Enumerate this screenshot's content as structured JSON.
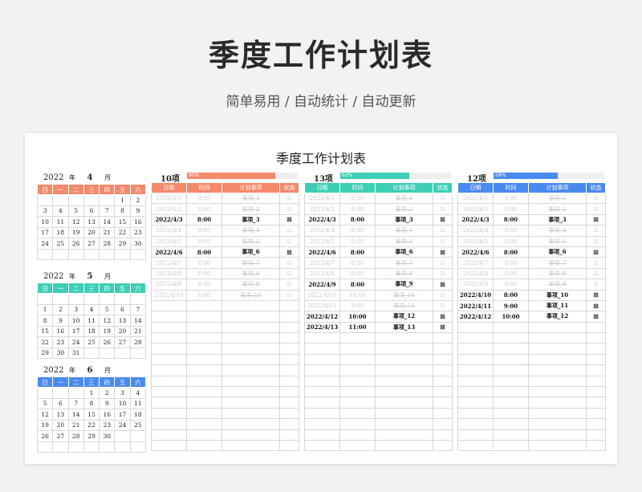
{
  "banner": {
    "title": "季度工作计划表",
    "subtitle": "简单易用  /  自动统计  /  自动更新"
  },
  "sheet": {
    "title": "季度工作计划表"
  },
  "labels": {
    "year_suffix": "年",
    "month_suffix": "月"
  },
  "weekdays": [
    "日",
    "一",
    "二",
    "三",
    "四",
    "五",
    "六"
  ],
  "colors": {
    "april": "#f4896b",
    "may": "#3dcfb5",
    "june": "#4a8af0"
  },
  "calendars": [
    {
      "year": "2022",
      "month": "4",
      "color": "#f4896b",
      "weeks": [
        [
          "",
          "",
          "",
          "",
          "",
          "1",
          "2"
        ],
        [
          "3",
          "4",
          "5",
          "6",
          "7",
          "8",
          "9"
        ],
        [
          "10",
          "11",
          "12",
          "13",
          "14",
          "15",
          "16"
        ],
        [
          "17",
          "18",
          "19",
          "20",
          "21",
          "22",
          "23"
        ],
        [
          "24",
          "25",
          "26",
          "27",
          "28",
          "29",
          "30"
        ],
        [
          "",
          "",
          "",
          "",
          "",
          "",
          ""
        ]
      ]
    },
    {
      "year": "2022",
      "month": "5",
      "color": "#3dcfb5",
      "weeks": [
        [
          "",
          "",
          "",
          "",
          "",
          "",
          ""
        ],
        [
          "1",
          "2",
          "3",
          "4",
          "5",
          "6",
          "7"
        ],
        [
          "8",
          "9",
          "10",
          "11",
          "12",
          "13",
          "14"
        ],
        [
          "15",
          "16",
          "17",
          "18",
          "19",
          "20",
          "21"
        ],
        [
          "22",
          "23",
          "24",
          "25",
          "26",
          "27",
          "28"
        ],
        [
          "29",
          "30",
          "31",
          "",
          "",
          "",
          ""
        ]
      ]
    },
    {
      "year": "2022",
      "month": "6",
      "color": "#4a8af0",
      "weeks": [
        [
          "",
          "",
          "",
          "1",
          "2",
          "3",
          "4"
        ],
        [
          "5",
          "6",
          "7",
          "8",
          "9",
          "10",
          "11"
        ],
        [
          "12",
          "13",
          "14",
          "15",
          "16",
          "17",
          "18"
        ],
        [
          "19",
          "20",
          "21",
          "22",
          "23",
          "24",
          "25"
        ],
        [
          "26",
          "27",
          "28",
          "29",
          "30",
          "",
          ""
        ],
        [
          "",
          "",
          "",
          "",
          "",
          "",
          ""
        ]
      ]
    }
  ],
  "task_columns": [
    "日期",
    "时间",
    "计划事项",
    "状态"
  ],
  "task_lists": [
    {
      "count": "10项",
      "percent_label": "80%",
      "progress": 0.8,
      "color": "#f4896b",
      "rows": [
        {
          "date": "2022/4/1",
          "time": "8:00",
          "item": "事项_1",
          "status": "☑",
          "done": true
        },
        {
          "date": "2022/4/2",
          "time": "8:00",
          "item": "事项_2",
          "status": "☑",
          "done": true
        },
        {
          "date": "2022/4/3",
          "time": "8:00",
          "item": "事项_3",
          "status": "☒",
          "done": false
        },
        {
          "date": "2022/4/4",
          "time": "8:00",
          "item": "事项_4",
          "status": "☑",
          "done": true
        },
        {
          "date": "2022/4/5",
          "time": "8:00",
          "item": "事项_5",
          "status": "☑",
          "done": true
        },
        {
          "date": "2022/4/6",
          "time": "8:00",
          "item": "事项_6",
          "status": "☒",
          "done": false
        },
        {
          "date": "2022/4/7",
          "time": "8:00",
          "item": "事项_7",
          "status": "☑",
          "done": true
        },
        {
          "date": "2022/4/8",
          "time": "8:00",
          "item": "事项_8",
          "status": "☑",
          "done": true
        },
        {
          "date": "2022/4/9",
          "time": "8:00",
          "item": "事项_9",
          "status": "☑",
          "done": true
        },
        {
          "date": "2022/4/10",
          "time": "8:00",
          "item": "事项_10",
          "status": "☑",
          "done": true
        }
      ]
    },
    {
      "count": "13项",
      "percent_label": "62%",
      "progress": 0.62,
      "color": "#3dcfb5",
      "rows": [
        {
          "date": "2022/4/1",
          "time": "8:00",
          "item": "事项_1",
          "status": "☑",
          "done": true
        },
        {
          "date": "2022/4/2",
          "time": "8:00",
          "item": "事项_2",
          "status": "☑",
          "done": true
        },
        {
          "date": "2022/4/3",
          "time": "8:00",
          "item": "事项_3",
          "status": "☒",
          "done": false
        },
        {
          "date": "2022/4/4",
          "time": "8:00",
          "item": "事项_4",
          "status": "☑",
          "done": true
        },
        {
          "date": "2022/4/5",
          "time": "8:00",
          "item": "事项_5",
          "status": "☑",
          "done": true
        },
        {
          "date": "2022/4/6",
          "time": "8:00",
          "item": "事项_6",
          "status": "☒",
          "done": false
        },
        {
          "date": "2022/4/7",
          "time": "8:00",
          "item": "事项_7",
          "status": "☑",
          "done": true
        },
        {
          "date": "2022/4/8",
          "time": "8:00",
          "item": "事项_8",
          "status": "☑",
          "done": true
        },
        {
          "date": "2022/4/9",
          "time": "8:00",
          "item": "事项_9",
          "status": "☒",
          "done": false
        },
        {
          "date": "2022/4/10",
          "time": "10:00",
          "item": "事项_10",
          "status": "☑",
          "done": true
        },
        {
          "date": "2022/4/11",
          "time": "9:00",
          "item": "事项_11",
          "status": "☑",
          "done": true
        },
        {
          "date": "2022/4/12",
          "time": "10:00",
          "item": "事项_12",
          "status": "☒",
          "done": false
        },
        {
          "date": "2022/4/13",
          "time": "11:00",
          "item": "事项_13",
          "status": "☒",
          "done": false
        }
      ]
    },
    {
      "count": "12项",
      "percent_label": "58%",
      "progress": 0.58,
      "color": "#4a8af0",
      "rows": [
        {
          "date": "2022/4/1",
          "time": "8:00",
          "item": "事项_1",
          "status": "☑",
          "done": true
        },
        {
          "date": "2022/4/2",
          "time": "8:00",
          "item": "事项_2",
          "status": "☑",
          "done": true
        },
        {
          "date": "2022/4/3",
          "time": "8:00",
          "item": "事项_3",
          "status": "☒",
          "done": false
        },
        {
          "date": "2022/4/4",
          "time": "8:00",
          "item": "事项_4",
          "status": "☑",
          "done": true
        },
        {
          "date": "2022/4/5",
          "time": "8:00",
          "item": "事项_5",
          "status": "☑",
          "done": true
        },
        {
          "date": "2022/4/6",
          "time": "8:00",
          "item": "事项_6",
          "status": "☒",
          "done": false
        },
        {
          "date": "2022/4/7",
          "time": "8:00",
          "item": "事项_7",
          "status": "☑",
          "done": true
        },
        {
          "date": "2022/4/8",
          "time": "8:00",
          "item": "事项_8",
          "status": "☑",
          "done": true
        },
        {
          "date": "2022/4/9",
          "time": "8:00",
          "item": "事项_9",
          "status": "☑",
          "done": true
        },
        {
          "date": "2022/4/10",
          "time": "8:00",
          "item": "事项_10",
          "status": "☒",
          "done": false
        },
        {
          "date": "2022/4/11",
          "time": "9:00",
          "item": "事项_11",
          "status": "☒",
          "done": false
        },
        {
          "date": "2022/4/12",
          "time": "10:00",
          "item": "事项_12",
          "status": "☒",
          "done": false
        }
      ]
    }
  ]
}
